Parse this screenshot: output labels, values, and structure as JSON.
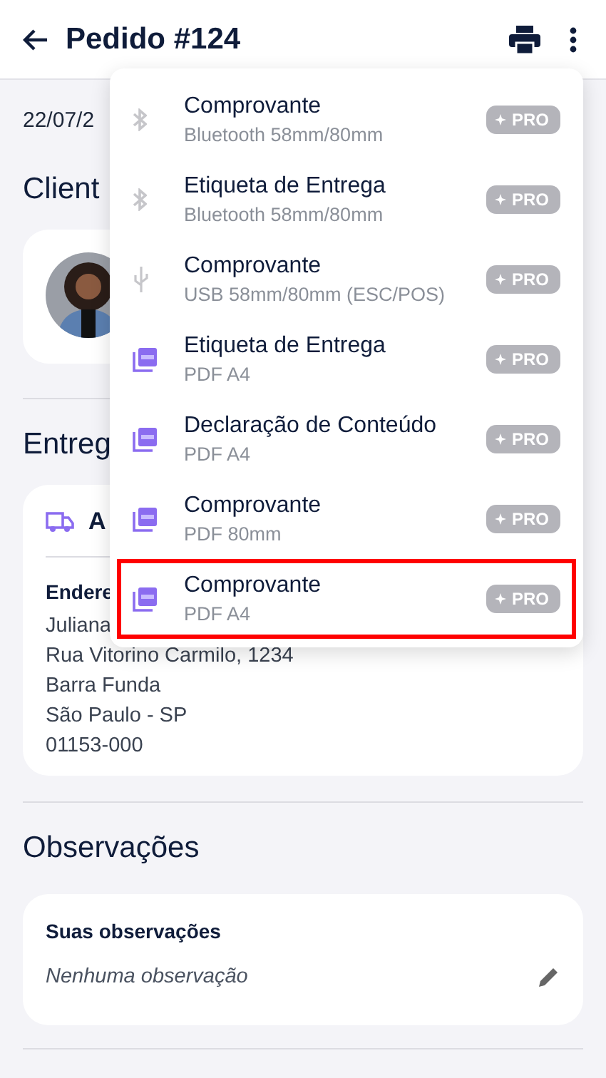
{
  "header": {
    "title": "Pedido #124"
  },
  "date": "22/07/2",
  "client_section": {
    "title": "Client"
  },
  "delivery_section": {
    "title": "Entreg",
    "card_title": "A",
    "address_label": "Endere",
    "address_lines": [
      "Juliana",
      "Rua Vitorino Carmilo, 1234",
      "Barra Funda",
      "São Paulo - SP",
      "01153-000"
    ]
  },
  "notes_section": {
    "title": "Observações",
    "label": "Suas observações",
    "value": "Nenhuma observação"
  },
  "print_menu": [
    {
      "kind": "bluetooth",
      "title": "Comprovante",
      "subtitle": "Bluetooth 58mm/80mm",
      "badge": "PRO",
      "selected": false
    },
    {
      "kind": "bluetooth",
      "title": "Etiqueta de Entrega",
      "subtitle": "Bluetooth 58mm/80mm",
      "badge": "PRO",
      "selected": false
    },
    {
      "kind": "usb",
      "title": "Comprovante",
      "subtitle": "USB 58mm/80mm (ESC/POS)",
      "badge": "PRO",
      "selected": false
    },
    {
      "kind": "pdf",
      "title": "Etiqueta de Entrega",
      "subtitle": "PDF A4",
      "badge": "PRO",
      "selected": false
    },
    {
      "kind": "pdf",
      "title": "Declaração de Conteúdo",
      "subtitle": "PDF A4",
      "badge": "PRO",
      "selected": false
    },
    {
      "kind": "pdf",
      "title": "Comprovante",
      "subtitle": "PDF 80mm",
      "badge": "PRO",
      "selected": false
    },
    {
      "kind": "pdf",
      "title": "Comprovante",
      "subtitle": "PDF A4",
      "badge": "PRO",
      "selected": true
    }
  ]
}
